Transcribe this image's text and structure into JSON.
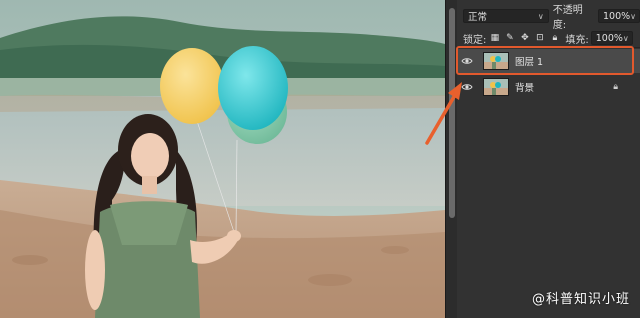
{
  "layers_panel": {
    "blend_mode": "正常",
    "opacity_label": "不透明度:",
    "opacity_value": "100%",
    "lock_label": "锁定:",
    "fill_label": "填充:",
    "fill_value": "100%",
    "layers": [
      {
        "name": "图层 1",
        "selected": true
      },
      {
        "name": "背景",
        "locked": true
      }
    ]
  },
  "watermark": "@科普知识小班",
  "colors": {
    "panel_bg": "#323232",
    "highlight": "#e2592d",
    "arrow": "#e8602d"
  },
  "icons": [
    "eye-icon",
    "lock-icon",
    "chevron-down-icon",
    "brush-icon",
    "move-icon",
    "crop-icon",
    "checkerboard-icon"
  ]
}
